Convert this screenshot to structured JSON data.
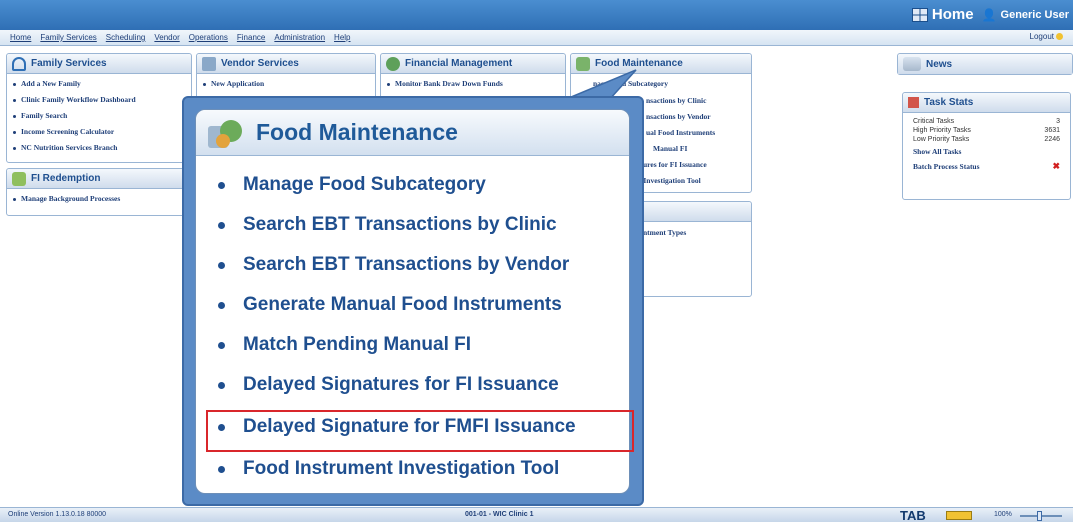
{
  "header": {
    "home_label": "Home",
    "user_label": "Generic User"
  },
  "menu": {
    "items": [
      "Home",
      "Family Services",
      "Scheduling",
      "Vendor",
      "Operations",
      "Finance",
      "Administration",
      "Help"
    ],
    "logout": "Logout"
  },
  "family_services": {
    "title": "Family Services",
    "items": [
      "Add a New Family",
      "Clinic Family Workflow Dashboard",
      "Family Search",
      "Income Screening Calculator",
      "NC Nutrition Services Branch"
    ]
  },
  "fi_redemption": {
    "title": "FI Redemption",
    "items": [
      "Manage Background Processes"
    ]
  },
  "vendor_services": {
    "title": "Vendor Services",
    "items": [
      "New Application"
    ]
  },
  "financial_management": {
    "title": "Financial Management",
    "items": [
      "Monitor Bank Draw Down Funds"
    ]
  },
  "food_maintenance_panel": {
    "title": "Food Maintenance",
    "items": [
      "nage Food Subcategory",
      "nsactions by Clinic",
      "nsactions by Vendor",
      "ual Food Instruments",
      "Manual FI",
      "ures for FI Issuance",
      "t Investigation Tool"
    ]
  },
  "scheduling_panel": {
    "title": "g",
    "items": [
      "ntment Types"
    ]
  },
  "news": {
    "title": "News"
  },
  "task_stats": {
    "title": "Task Stats",
    "rows": [
      {
        "label": "Critical Tasks",
        "value": "3"
      },
      {
        "label": "High Priority Tasks",
        "value": "3631"
      },
      {
        "label": "Low Priority Tasks",
        "value": "2246"
      }
    ],
    "show_all": "Show All Tasks",
    "batch": "Batch Process Status"
  },
  "zoom": {
    "title": "Food Maintenance",
    "items": [
      "Manage Food Subcategory",
      "Search EBT Transactions by Clinic",
      "Search EBT Transactions by Vendor",
      "Generate Manual Food Instruments",
      "Match Pending Manual FI",
      "Delayed Signatures for FI Issuance",
      "Delayed Signature for FMFI Issuance",
      "Food Instrument Investigation Tool"
    ],
    "highlighted_index": 6
  },
  "status": {
    "left": "Online   Version 1.13.0.18  80000",
    "center": "001-01 - WIC Clinic 1",
    "tab": "TAB",
    "zoom": "100%"
  },
  "colors": {
    "accent": "#2f6fb5",
    "highlight": "#d9262b"
  }
}
